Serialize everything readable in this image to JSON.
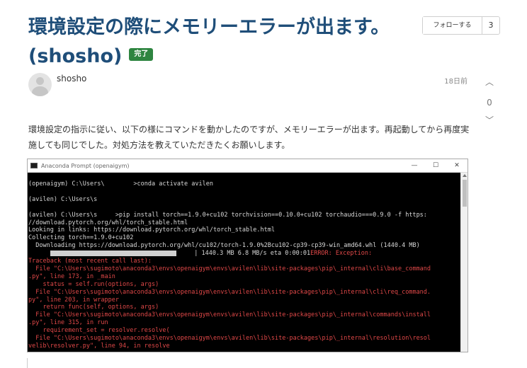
{
  "question": {
    "title": "環境設定の際にメモリーエラーが出ます。(shosho)",
    "status_badge": "完了",
    "follow_label": "フォローする",
    "follow_count": "3",
    "author": "shosho",
    "timestamp": "18日前",
    "vote_count": "0",
    "body": "環境設定の指示に従い、以下の様にコマンドを動かしたのですが、メモリーエラーが出ます。再起動してから再度実施しても同じでした。対処方法を教えていただきたくお願いします。"
  },
  "terminal": {
    "window_title": "Anaconda Prompt (openaigym)",
    "controls": [
      "—",
      "☐",
      "✕"
    ],
    "lines": [
      {
        "type": "w",
        "text": "(openaigym) C:\\Users\\        >conda activate avilen"
      },
      {
        "type": "gap",
        "text": ""
      },
      {
        "type": "w",
        "text": "(avilen) C:\\Users\\s"
      },
      {
        "type": "gap",
        "text": ""
      },
      {
        "type": "w",
        "text": "(avilen) C:\\Users\\s     >pip install torch==1.9.0+cu102 torchvision==0.10.0+cu102 torchaudio===0.9.0 -f https:"
      },
      {
        "type": "w",
        "text": "//download.pytorch.org/whl/torch_stable.html"
      },
      {
        "type": "w",
        "text": "Looking in links: https://download.pytorch.org/whl/torch_stable.html"
      },
      {
        "type": "w",
        "text": "Collecting torch==1.9.0+cu102"
      },
      {
        "type": "w",
        "text": "  Downloading https://download.pytorch.org/whl/cu102/torch-1.9.0%2Bcu102-cp39-cp39-win_amd64.whl (1440.4 MB)"
      },
      {
        "type": "progress",
        "text": "     | 1440.3 MB 6.8 MB/s eta 0:00:01",
        "error": "ERROR: Exception:"
      },
      {
        "type": "r",
        "text": "Traceback (most recent call last):"
      },
      {
        "type": "r",
        "text": "  File \"C:\\Users\\sugimoto\\anaconda3\\envs\\openaigym\\envs\\avilen\\lib\\site-packages\\pip\\_internal\\cli\\base_command"
      },
      {
        "type": "r",
        "text": ".py\", line 173, in _main"
      },
      {
        "type": "r",
        "text": "    status = self.run(options, args)"
      },
      {
        "type": "r",
        "text": "  File \"C:\\Users\\sugimoto\\anaconda3\\envs\\openaigym\\envs\\avilen\\lib\\site-packages\\pip\\_internal\\cli\\req_command."
      },
      {
        "type": "r",
        "text": "py\", line 203, in wrapper"
      },
      {
        "type": "r",
        "text": "    return func(self, options, args)"
      },
      {
        "type": "r",
        "text": "  File \"C:\\Users\\sugimoto\\anaconda3\\envs\\openaigym\\envs\\avilen\\lib\\site-packages\\pip\\_internal\\commands\\install"
      },
      {
        "type": "r",
        "text": ".py\", line 315, in run"
      },
      {
        "type": "r",
        "text": "    requirement_set = resolver.resolve("
      },
      {
        "type": "r",
        "text": "  File \"C:\\Users\\sugimoto\\anaconda3\\envs\\openaigym\\envs\\avilen\\lib\\site-packages\\pip\\_internal\\resolution\\resol"
      },
      {
        "type": "r",
        "text": "velib\\resolver.py\", line 94, in resolve"
      }
    ]
  }
}
